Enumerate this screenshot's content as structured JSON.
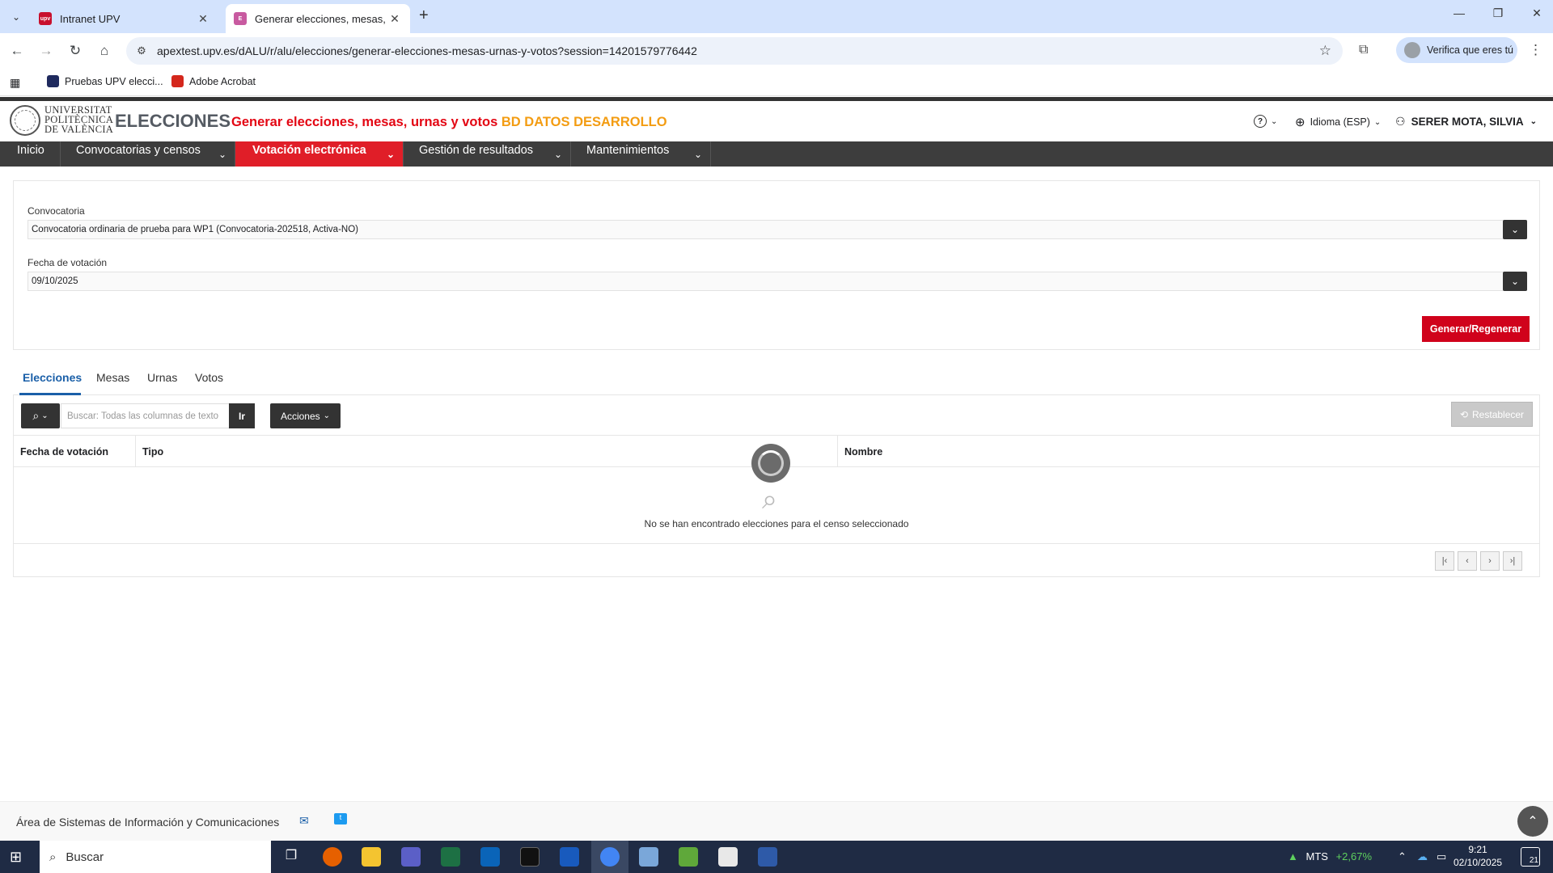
{
  "browser": {
    "tabs": [
      {
        "title": "Intranet UPV",
        "favicon_text": "upv"
      },
      {
        "title": "Generar elecciones, mesas, urna",
        "favicon_text": "E"
      }
    ],
    "url": "apextest.upv.es/dALU/r/alu/elecciones/generar-elecciones-mesas-urnas-y-votos?session=14201579776442",
    "profile_label": "Verifica que eres tú",
    "bookmarks": [
      {
        "label": "Pruebas UPV elecci..."
      },
      {
        "label": "Adobe Acrobat"
      }
    ]
  },
  "header": {
    "logo_lines": [
      "UNIVERSITAT",
      "POLITÈCNICA",
      "DE VALÈNCIA"
    ],
    "app_name": "ELECCIONES",
    "page_title": "Generar elecciones, mesas, urnas y votos",
    "env_label": "BD DATOS DESARROLLO",
    "help_label": "?",
    "language_label": "Idioma (ESP)",
    "user_name": "SERER MOTA, SILVIA"
  },
  "menu": {
    "items": [
      {
        "label": "Inicio"
      },
      {
        "label": "Convocatorias y censos"
      },
      {
        "label": "Votación electrónica"
      },
      {
        "label": "Gestión de resultados"
      },
      {
        "label": "Mantenimientos"
      }
    ]
  },
  "form": {
    "convocatoria_label": "Convocatoria",
    "convocatoria_value": "Convocatoria ordinaria de prueba para WP1  (Convocatoria-202518,  Activa-NO)",
    "fecha_label": "Fecha de votación",
    "fecha_value": "09/10/2025",
    "generate_button": "Generar/Regenerar"
  },
  "region_tabs": [
    "Elecciones",
    "Mesas",
    "Urnas",
    "Votos"
  ],
  "report": {
    "search_placeholder": "Buscar: Todas las columnas de texto",
    "go_button": "Ir",
    "actions_button": "Acciones",
    "reset_button": "Restablecer",
    "columns": [
      "Fecha de votación",
      "Tipo",
      "Nombre"
    ],
    "empty_message": "No se han encontrado elecciones para el censo seleccionado"
  },
  "footer": {
    "text": "Área de Sistemas de Información y Comunicaciones"
  },
  "taskbar": {
    "search_label": "Buscar",
    "stock_label": "MTS",
    "stock_change": "+2,67%",
    "time": "9:21",
    "date": "02/10/2025",
    "notification_count": "21"
  },
  "colors": {
    "accent_red": "#e01e28",
    "env_orange": "#f39c12",
    "tab_blue": "#1a5fa8",
    "menubar": "#3d3d3d"
  }
}
